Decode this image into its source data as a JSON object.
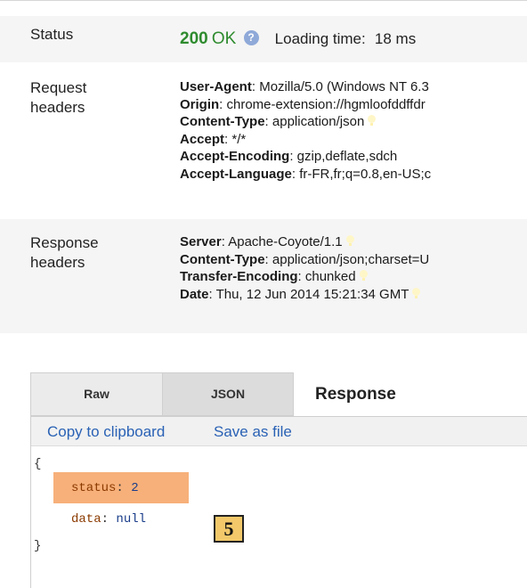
{
  "status": {
    "label": "Status",
    "code": "200",
    "text": "OK",
    "help_icon": "question-circle-icon",
    "loading_label": "Loading time:",
    "loading_value": "18 ms"
  },
  "request_headers": {
    "label_line1": "Request",
    "label_line2": "headers",
    "items": [
      {
        "name": "User-Agent",
        "value": ": Mozilla/5.0 (Windows NT 6.3",
        "hint": false
      },
      {
        "name": "Origin",
        "value": ": chrome-extension://hgmloofddffdr",
        "hint": false
      },
      {
        "name": "Content-Type",
        "value": ": application/json",
        "hint": true
      },
      {
        "name": "Accept",
        "value": ": */*",
        "hint": false
      },
      {
        "name": "Accept-Encoding",
        "value": ": gzip,deflate,sdch",
        "hint": false
      },
      {
        "name": "Accept-Language",
        "value": ": fr-FR,fr;q=0.8,en-US;c",
        "hint": false
      }
    ]
  },
  "response_headers": {
    "label_line1": "Response",
    "label_line2": "headers",
    "items": [
      {
        "name": "Server",
        "value": ": Apache-Coyote/1.1",
        "hint": true
      },
      {
        "name": "Content-Type",
        "value": ": application/json;charset=U",
        "hint": false
      },
      {
        "name": "Transfer-Encoding",
        "value": ": chunked",
        "hint": true
      },
      {
        "name": "Date",
        "value": ": Thu, 12 Jun 2014 15:21:34 GMT",
        "hint": true
      }
    ]
  },
  "tabs": {
    "raw": "Raw",
    "json": "JSON",
    "response_title": "Response"
  },
  "toolbar": {
    "copy_label": "Copy to clipboard",
    "save_label": "Save as file"
  },
  "json_view": {
    "open_brace": "{",
    "close_brace": "}",
    "status_key": "status",
    "status_value": "2",
    "data_key": "data",
    "data_value": "null"
  },
  "annotation": {
    "badge_number": "5"
  },
  "colors": {
    "status_ok": "#2e8b2e",
    "link": "#2a62b5",
    "highlight": "#f7b07a",
    "badge": "#f2c86a"
  }
}
